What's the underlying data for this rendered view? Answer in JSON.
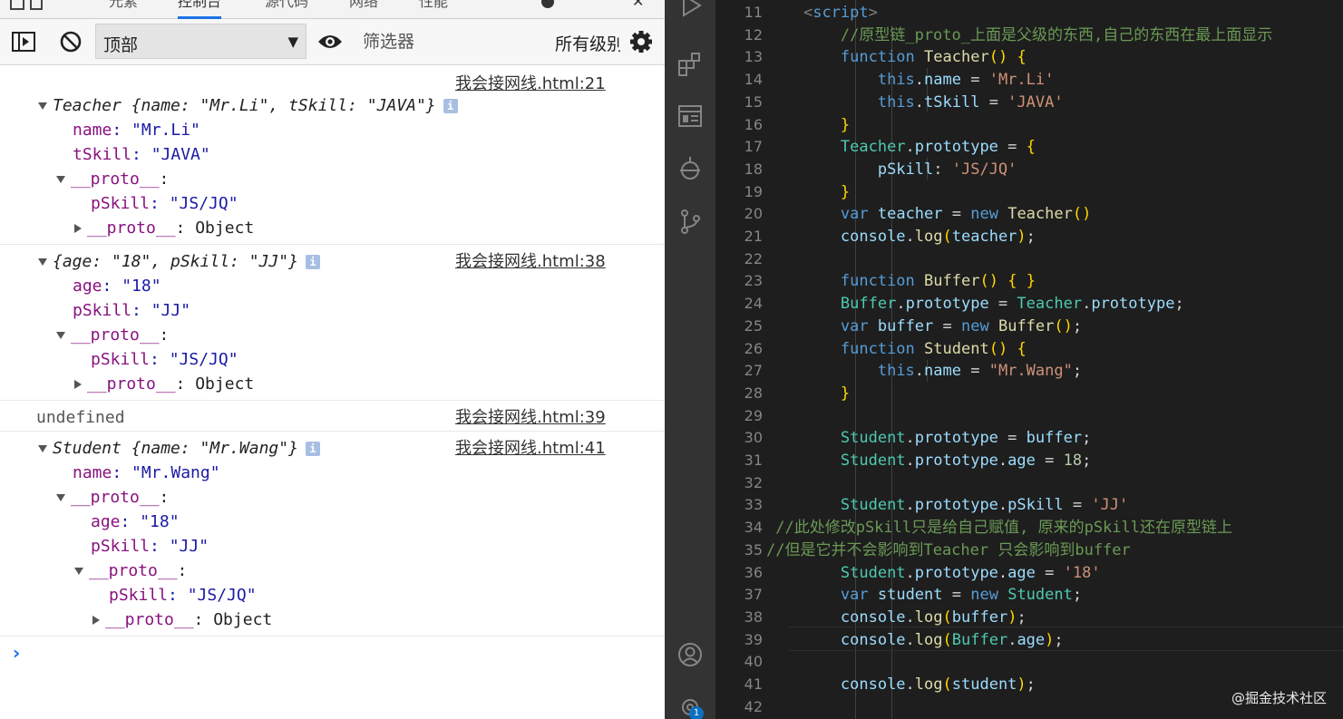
{
  "devtools": {
    "tabs": [
      "元素",
      "控制台",
      "源代码",
      "网络",
      "性能"
    ],
    "active_tab": "控制台",
    "toolbar": {
      "context_value": "顶部",
      "filter_placeholder": "筛选器",
      "levels_label": "所有级别"
    },
    "messages": [
      {
        "source": "我会接网线.html:21",
        "summary": "Teacher {name: \"Mr.Li\", tSkill: \"JAVA\"}",
        "lines": [
          "name: \"Mr.Li\"",
          "tSkill: \"JAVA\"",
          "__proto__:",
          "pSkill: \"JS/JQ\"",
          "__proto__: Object"
        ]
      },
      {
        "source": "我会接网线.html:38",
        "summary": "{age: \"18\", pSkill: \"JJ\"}",
        "lines": [
          "age: \"18\"",
          "pSkill: \"JJ\"",
          "__proto__:",
          "pSkill: \"JS/JQ\"",
          "__proto__: Object"
        ]
      },
      {
        "source": "我会接网线.html:39",
        "summary": "undefined"
      },
      {
        "source": "我会接网线.html:41",
        "summary": "Student {name: \"Mr.Wang\"}",
        "lines": [
          "name: \"Mr.Wang\"",
          "__proto__:",
          "age: \"18\"",
          "pSkill: \"JJ\"",
          "__proto__:",
          "pSkill: \"JS/JQ\"",
          "__proto__: Object"
        ]
      }
    ],
    "prompt": "›"
  },
  "editor": {
    "line_numbers": [
      11,
      12,
      13,
      14,
      15,
      16,
      17,
      18,
      19,
      20,
      21,
      22,
      23,
      24,
      25,
      26,
      27,
      28,
      29,
      30,
      31,
      32,
      33,
      34,
      35,
      36,
      37,
      38,
      39,
      40,
      41,
      42
    ],
    "code": [
      "    <script>",
      "        //原型链_proto_上面是父级的东西,自己的东西在最上面显示",
      "        function Teacher() {",
      "            this.name = 'Mr.Li'",
      "            this.tSkill = 'JAVA'",
      "        }",
      "        Teacher.prototype = {",
      "            pSkill: 'JS/JQ'",
      "        }",
      "        var teacher = new Teacher()",
      "        console.log(teacher);",
      "",
      "        function Buffer() { }",
      "        Buffer.prototype = Teacher.prototype;",
      "        var buffer = new Buffer();",
      "        function Student() {",
      "            this.name = \"Mr.Wang\";",
      "        }",
      "",
      "        Student.prototype = buffer;",
      "        Student.prototype.age = 18;",
      "",
      "        Student.prototype.pSkill = 'JJ'",
      " //此处修改pSkill只是给自己赋值, 原来的pSkill还在原型链上",
      "//但是它并不会影响到Teacher 只会影响到buffer",
      "        Student.prototype.age = '18'",
      "        var student = new Student;",
      "        console.log(buffer);",
      "        console.log(Buffer.age);",
      "",
      "        console.log(student);",
      ""
    ],
    "badge": "1",
    "watermark": "@掘金技术社区"
  }
}
